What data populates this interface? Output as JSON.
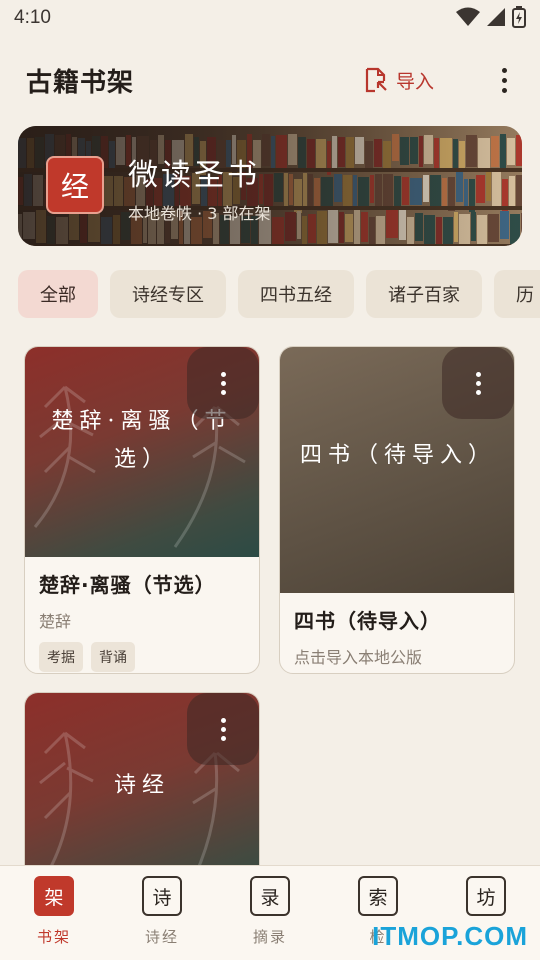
{
  "status": {
    "time": "4:10"
  },
  "appbar": {
    "title": "古籍书架",
    "import_label": "导入"
  },
  "banner": {
    "seal": "经",
    "title": "微读圣书",
    "subtitle": "本地卷帙 · 3 部在架"
  },
  "chips": [
    "全部",
    "诗经专区",
    "四书五经",
    "诸子百家",
    "历"
  ],
  "books": [
    {
      "cover_text": "楚辞·离骚（节选）",
      "title": "楚辞·离骚（节选）",
      "subtitle": "楚辞",
      "tags": [
        "考据",
        "背诵"
      ]
    },
    {
      "cover_text": "四书（待导入）",
      "title": "四书（待导入）",
      "subtitle": "点击导入本地公版"
    },
    {
      "cover_text": "诗经"
    }
  ],
  "nav": [
    {
      "glyph": "架",
      "label": "书架"
    },
    {
      "glyph": "诗",
      "label": "诗经"
    },
    {
      "glyph": "录",
      "label": "摘录"
    },
    {
      "glyph": "索",
      "label": "检"
    },
    {
      "glyph": "坊",
      "label": ""
    }
  ],
  "watermark": "ITMOP.COM",
  "colors": {
    "accent": "#c0392b",
    "background": "#f4efe7"
  }
}
